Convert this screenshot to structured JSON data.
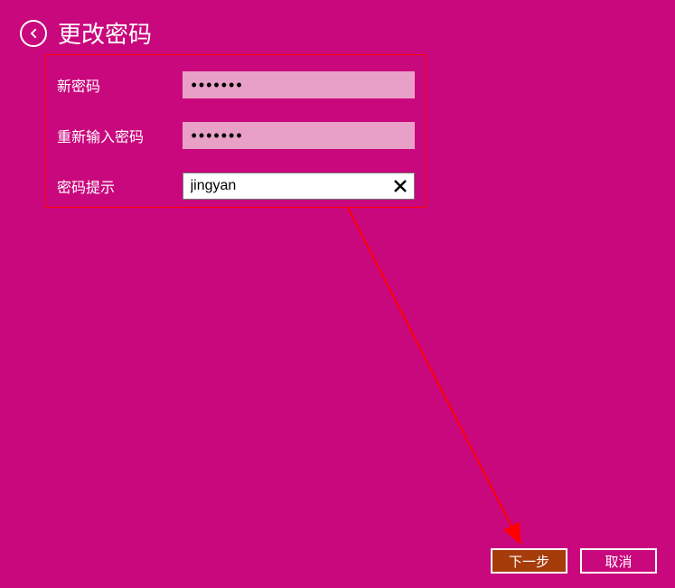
{
  "header": {
    "title": "更改密码"
  },
  "form": {
    "new_password_label": "新密码",
    "new_password_value": "•••••••",
    "confirm_password_label": "重新输入密码",
    "confirm_password_value": "•••••••",
    "hint_label": "密码提示",
    "hint_value": "jingyan"
  },
  "footer": {
    "next_label": "下一步",
    "cancel_label": "取消"
  },
  "colors": {
    "background": "#c9087d",
    "highlight_border": "#ff0000",
    "next_button_bg": "#a63c0a"
  }
}
